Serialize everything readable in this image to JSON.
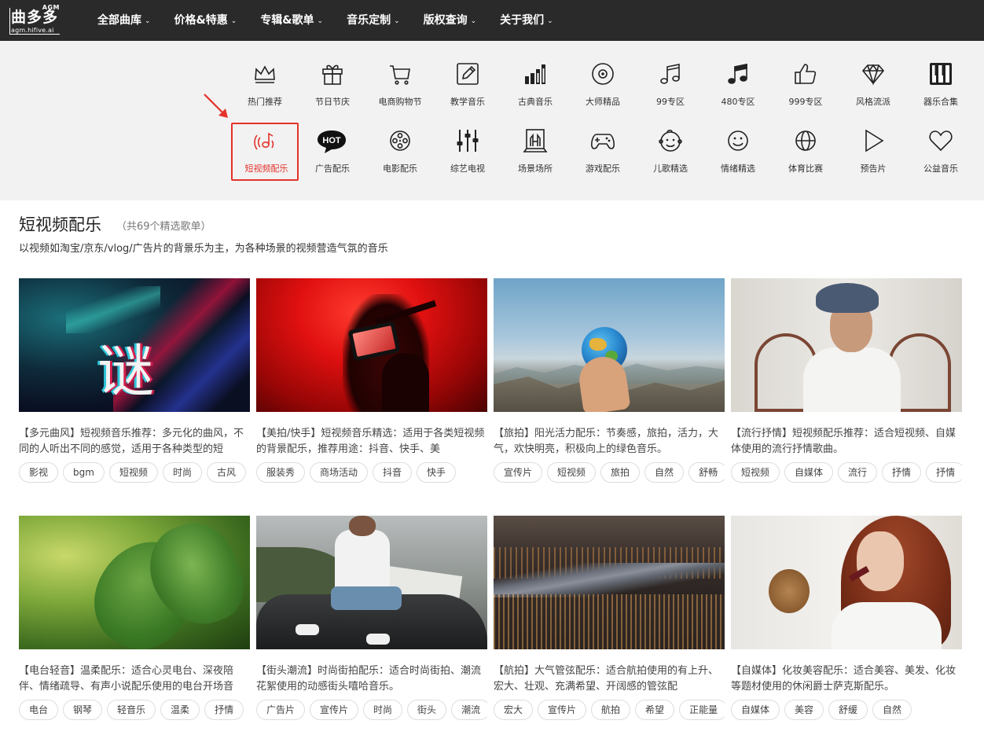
{
  "logo": {
    "agm": "AGM",
    "text": "曲多多",
    "domain": "agm.hifive.ai"
  },
  "nav": [
    {
      "label": "全部曲库"
    },
    {
      "label": "价格&特惠"
    },
    {
      "label": "专辑&歌单"
    },
    {
      "label": "音乐定制"
    },
    {
      "label": "版权查询"
    },
    {
      "label": "关于我们"
    }
  ],
  "categories_row1": [
    {
      "label": "热门推荐",
      "icon": "crown-icon"
    },
    {
      "label": "节日节庆",
      "icon": "gift-icon"
    },
    {
      "label": "电商购物节",
      "icon": "shopping-cart-icon"
    },
    {
      "label": "教学音乐",
      "icon": "edit-icon"
    },
    {
      "label": "古典音乐",
      "icon": "bars-chart-icon"
    },
    {
      "label": "大师精品",
      "icon": "disc-icon"
    },
    {
      "label": "99专区",
      "icon": "music-note-icon"
    },
    {
      "label": "480专区",
      "icon": "music-notes-filled-icon"
    },
    {
      "label": "999专区",
      "icon": "thumbs-up-icon"
    },
    {
      "label": "风格流派",
      "icon": "diamond-icon"
    },
    {
      "label": "器乐合集",
      "icon": "piano-icon"
    }
  ],
  "categories_row2": [
    {
      "label": "短视频配乐",
      "icon": "short-video-music-icon",
      "active": true
    },
    {
      "label": "广告配乐",
      "icon": "hot-badge-icon",
      "badge": "HOT"
    },
    {
      "label": "电影配乐",
      "icon": "film-reel-icon"
    },
    {
      "label": "综艺电视",
      "icon": "mixer-sliders-icon"
    },
    {
      "label": "场景场所",
      "icon": "scene-icon"
    },
    {
      "label": "游戏配乐",
      "icon": "gamepad-icon"
    },
    {
      "label": "儿歌精选",
      "icon": "baby-face-icon"
    },
    {
      "label": "情绪精选",
      "icon": "smile-icon"
    },
    {
      "label": "体育比赛",
      "icon": "globe-icon"
    },
    {
      "label": "预告片",
      "icon": "play-icon"
    },
    {
      "label": "公益音乐",
      "icon": "heart-icon"
    }
  ],
  "heading": {
    "title": "短视频配乐",
    "count": "（共69个精选歌单）",
    "description": "以视频如淘宝/京东/vlog/广告片的背景乐为主，为各种场景的视频营造气氛的音乐"
  },
  "cards": [
    {
      "text": "【多元曲风】短视频音乐推荐：多元化的曲风，不同的人听出不同的感觉，适用于各种类型的短",
      "tags": [
        "影视",
        "bgm",
        "短视频",
        "时尚",
        "古风"
      ],
      "image": "neon-calligraphy"
    },
    {
      "text": "【美拍/快手】短视频音乐精选：适用于各类短视频的背景配乐，推荐用途：抖音、快手、美",
      "tags": [
        "服装秀",
        "商场活动",
        "抖音",
        "快手"
      ],
      "image": "red-concert"
    },
    {
      "text": "【旅拍】阳光活力配乐：节奏感，旅拍，活力，大气，欢快明亮，积极向上的绿色音乐。",
      "tags": [
        "宣传片",
        "短视频",
        "旅拍",
        "自然",
        "舒畅"
      ],
      "image": "globe-mountains"
    },
    {
      "text": "【流行抒情】短视频配乐推荐：适合短视频、自媒体使用的流行抒情歌曲。",
      "tags": [
        "短视频",
        "自媒体",
        "流行",
        "抒情",
        "抒情"
      ],
      "image": "man-cap"
    },
    {
      "text": "【电台轻音】温柔配乐：适合心灵电台、深夜陪伴、情绪疏导、有声小说配乐使用的电台开场音",
      "tags": [
        "电台",
        "钢琴",
        "轻音乐",
        "温柔",
        "抒情"
      ],
      "image": "green-leaf"
    },
    {
      "text": "【街头潮流】时尚街拍配乐：适合时尚街拍、潮流花絮使用的动感街头嘻哈音乐。",
      "tags": [
        "广告片",
        "宣传片",
        "时尚",
        "街头",
        "潮流"
      ],
      "image": "street-car"
    },
    {
      "text": "【航拍】大气管弦配乐：适合航拍使用的有上升、宏大、壮观、充满希望、开阔感的管弦配",
      "tags": [
        "宏大",
        "宣传片",
        "航拍",
        "希望",
        "正能量"
      ],
      "image": "city-night"
    },
    {
      "text": "【自媒体】化妆美容配乐：适合美容、美发、化妆等题材使用的休闲爵士萨克斯配乐。",
      "tags": [
        "自媒体",
        "美容",
        "舒缓",
        "自然"
      ],
      "image": "woman-makeup"
    }
  ]
}
